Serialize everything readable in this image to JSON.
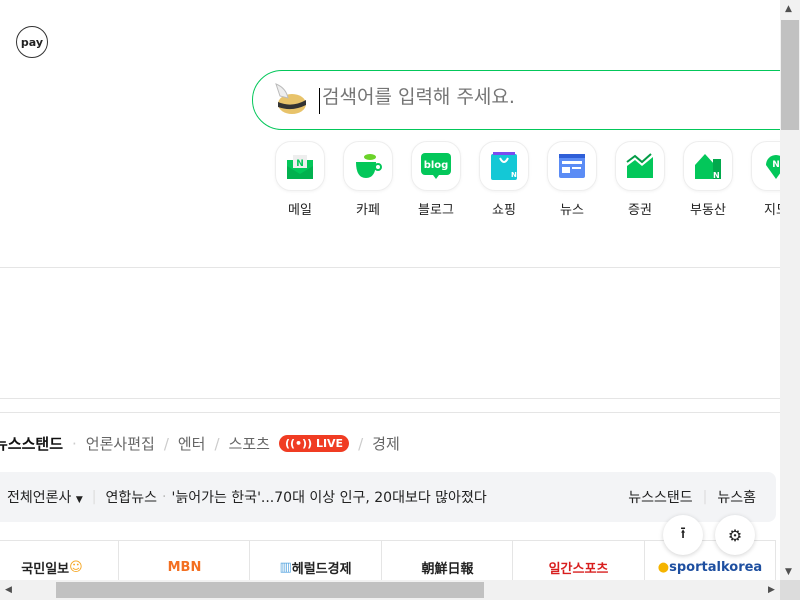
{
  "header": {
    "pay_label": "pay"
  },
  "search": {
    "placeholder": "검색어를 입력해 주세요."
  },
  "shortcuts": [
    {
      "label": "메일",
      "icon": "mail-icon"
    },
    {
      "label": "카페",
      "icon": "cafe-icon"
    },
    {
      "label": "블로그",
      "icon": "blog-icon",
      "text": "blog"
    },
    {
      "label": "쇼핑",
      "icon": "shopping-icon"
    },
    {
      "label": "뉴스",
      "icon": "news-icon"
    },
    {
      "label": "증권",
      "icon": "stock-icon"
    },
    {
      "label": "부동산",
      "icon": "real-estate-icon"
    },
    {
      "label": "지도",
      "icon": "map-icon"
    }
  ],
  "news": {
    "tabs": [
      "뉴스스탠드",
      "언론사편집",
      "엔터",
      "스포츠",
      "경제"
    ],
    "live_badge": "LIVE",
    "press_filter": "전체언론사",
    "headline_source": "연합뉴스",
    "headline": "'늙어가는 한국'...70대 이상 인구, 20대보다 많아졌다",
    "links": [
      "뉴스스탠드",
      "뉴스홈"
    ],
    "press": [
      "국민일보",
      "MBN",
      "헤럴드경제",
      "朝鮮日報",
      "일간스포츠",
      "sportalkorea"
    ]
  },
  "colors": {
    "accent": "#03c75a",
    "live": "#f03c23"
  }
}
